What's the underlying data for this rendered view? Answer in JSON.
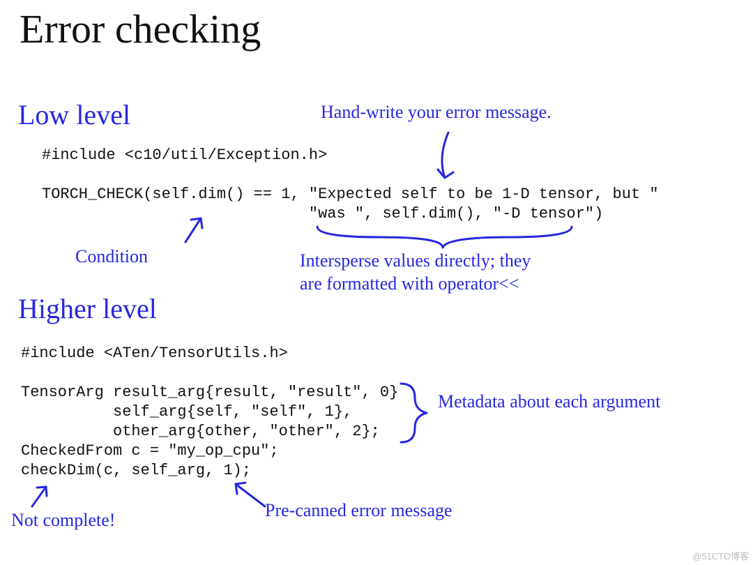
{
  "title": "Error checking",
  "low": {
    "heading": "Low level",
    "code1": "#include <c10/util/Exception.h>",
    "code2a": "TORCH_CHECK(self.dim() == 1, \"Expected self to be 1-D tensor, but \"",
    "code2b": "                             \"was \", self.dim(), \"-D tensor\")",
    "note_cond": "Condition",
    "note_hand": "Hand-write your error message.",
    "note_intersperse": "Intersperse values directly; they\nare formatted with operator<<"
  },
  "high": {
    "heading": "Higher level",
    "code1": "#include <ATen/TensorUtils.h>",
    "code2a": "TensorArg result_arg{result, \"result\", 0}",
    "code2b": "          self_arg{self, \"self\", 1},",
    "code2c": "          other_arg{other, \"other\", 2};",
    "code3": "CheckedFrom c = \"my_op_cpu\";",
    "code4": "checkDim(c, self_arg, 1);",
    "note_meta": "Metadata about each argument",
    "note_notcomplete": "Not complete!",
    "note_precanned": "Pre-canned error message"
  },
  "watermark": "@51CTO博客"
}
